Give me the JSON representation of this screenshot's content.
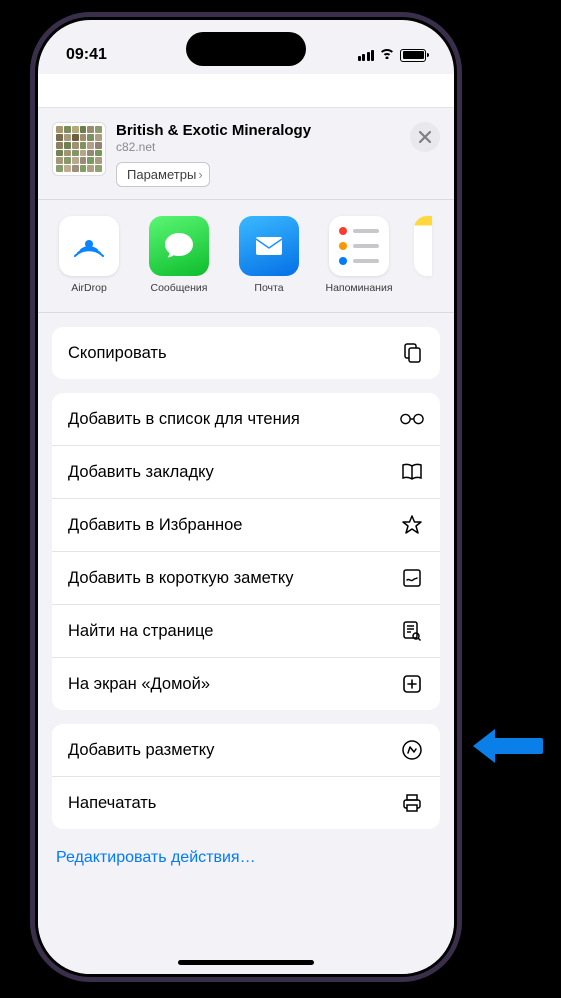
{
  "status": {
    "time": "09:41"
  },
  "header": {
    "title": "British & Exotic Mineralogy",
    "subtitle": "c82.net",
    "params_label": "Параметры"
  },
  "apps": [
    {
      "label": "AirDrop",
      "icon": "airdrop"
    },
    {
      "label": "Сообщения",
      "icon": "messages"
    },
    {
      "label": "Почта",
      "icon": "mail"
    },
    {
      "label": "Напоминания",
      "icon": "reminders"
    }
  ],
  "actions": {
    "group1": [
      {
        "label": "Скопировать",
        "icon": "copy"
      }
    ],
    "group2": [
      {
        "label": "Добавить в список для чтения",
        "icon": "glasses"
      },
      {
        "label": "Добавить закладку",
        "icon": "book"
      },
      {
        "label": "Добавить в Избранное",
        "icon": "star"
      },
      {
        "label": "Добавить в короткую заметку",
        "icon": "quicknote"
      },
      {
        "label": "Найти на странице",
        "icon": "find"
      },
      {
        "label": "На экран «Домой»",
        "icon": "addhome"
      }
    ],
    "group3": [
      {
        "label": "Добавить разметку",
        "icon": "markup"
      },
      {
        "label": "Напечатать",
        "icon": "print"
      }
    ]
  },
  "edit_label": "Редактировать действия…",
  "thumbnail_colors": [
    "#a8956b",
    "#7a8b5e",
    "#b5a87c",
    "#6b7d4f",
    "#9a8b6e",
    "#8b9d6f",
    "#7c6d4e",
    "#a89b7d",
    "#6e5f3f",
    "#9c8d6f",
    "#7d8e5f",
    "#ad9e80",
    "#8e7f60",
    "#6f8051",
    "#9f9072",
    "#809162",
    "#b0a183",
    "#918273",
    "#728354",
    "#a29375",
    "#839466",
    "#b4a587",
    "#958678",
    "#769759",
    "#a6977a",
    "#87986b",
    "#b8a98c",
    "#998a7c",
    "#7a9b5d",
    "#a99c7e",
    "#8b9c6e",
    "#bcac90",
    "#9d8e80",
    "#7e9f61",
    "#ad9f82",
    "#8fa072"
  ]
}
